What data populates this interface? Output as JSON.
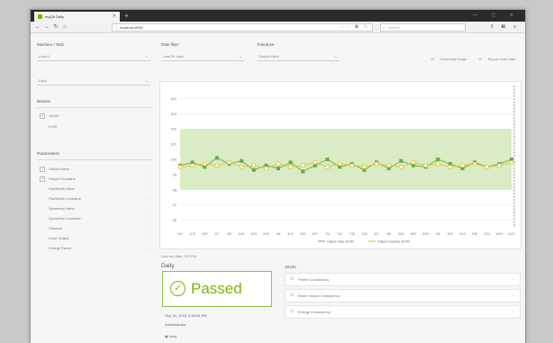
{
  "browser": {
    "tab_title": "myQA Daily",
    "url": "localhost:8080",
    "search_placeholder": "Search"
  },
  "sidebar": {
    "machine_label": "Machine / Task",
    "machine_value": "Linac 1",
    "task_value": "Daily",
    "beams_label": "Beams",
    "beams": [
      {
        "label": "18 MV",
        "checked": true
      },
      {
        "label": "6 MV",
        "checked": false
      }
    ],
    "parameters_label": "Parameters",
    "parameters": [
      {
        "label": "Output Inline",
        "checked": true
      },
      {
        "label": "Output Crossline",
        "checked": true
      },
      {
        "label": "Flat/Width Inline",
        "checked": false
      },
      {
        "label": "Flat/Width Crossline",
        "checked": false
      },
      {
        "label": "Symmetry Inline",
        "checked": false
      },
      {
        "label": "Symmetry Crossline",
        "checked": false
      },
      {
        "label": "Flatness",
        "checked": false
      },
      {
        "label": "Dose Output",
        "checked": false
      },
      {
        "label": "Energy Factor",
        "checked": false
      }
    ]
  },
  "filters": {
    "date_label": "Date filter",
    "date_value": "Last 30 days",
    "tolerance_label": "Tolerance",
    "tolerance_value": "Output Inline"
  },
  "actions": {
    "download": "Download image",
    "export": "Export chart data"
  },
  "chart_data": {
    "type": "line",
    "x": [
      "4/11",
      "4/18",
      "4/25",
      "5/2",
      "5/9",
      "5/16",
      "5/23",
      "5/30",
      "6/6",
      "6/13",
      "6/20",
      "6/27",
      "7/4",
      "7/11",
      "7/18",
      "7/25",
      "8/1",
      "8/8",
      "8/15",
      "8/22",
      "8/29",
      "9/5",
      "9/12",
      "9/19",
      "9/26",
      "10/3",
      "10/10",
      "10/17"
    ],
    "yticks": [
      96,
      97,
      98,
      99,
      100,
      101,
      102,
      103,
      104
    ],
    "ylim": [
      95.5,
      104.5
    ],
    "tolerance_band": [
      98,
      102
    ],
    "series": [
      {
        "name": "Output Inline 18 MV",
        "color": "#6aa84f",
        "values": [
          99.6,
          99.8,
          99.5,
          100.1,
          99.7,
          99.9,
          99.3,
          99.6,
          99.4,
          99.8,
          99.2,
          99.6,
          100.0,
          99.5,
          99.7,
          99.3,
          99.8,
          99.4,
          99.9,
          99.6,
          99.5,
          100.0,
          99.7,
          99.4,
          99.8,
          99.5,
          99.7,
          100.0
        ]
      },
      {
        "name": "Output Crossline 18 MV",
        "color": "#e6c229",
        "values": [
          99.5,
          99.6,
          99.7,
          99.6,
          99.8,
          99.5,
          99.6,
          99.4,
          99.7,
          99.5,
          99.6,
          99.8,
          99.5,
          99.7,
          99.6,
          99.5,
          99.7,
          99.6,
          99.5,
          99.8,
          99.6,
          99.7,
          99.5,
          99.6,
          99.7,
          99.5,
          99.6,
          99.8
        ]
      }
    ]
  },
  "summary": {
    "last_run": "Last run date: 9/17/18",
    "daily_title": "Daily",
    "energy_title": "18 MV",
    "status": "Passed",
    "timestamp": "Sep 18, 2018, 2:48:36 PM",
    "user": "Administrator",
    "view_link": "View",
    "checks": [
      "Profile Consistency",
      "Beam Output Consistency",
      "Energy Consistency"
    ]
  }
}
